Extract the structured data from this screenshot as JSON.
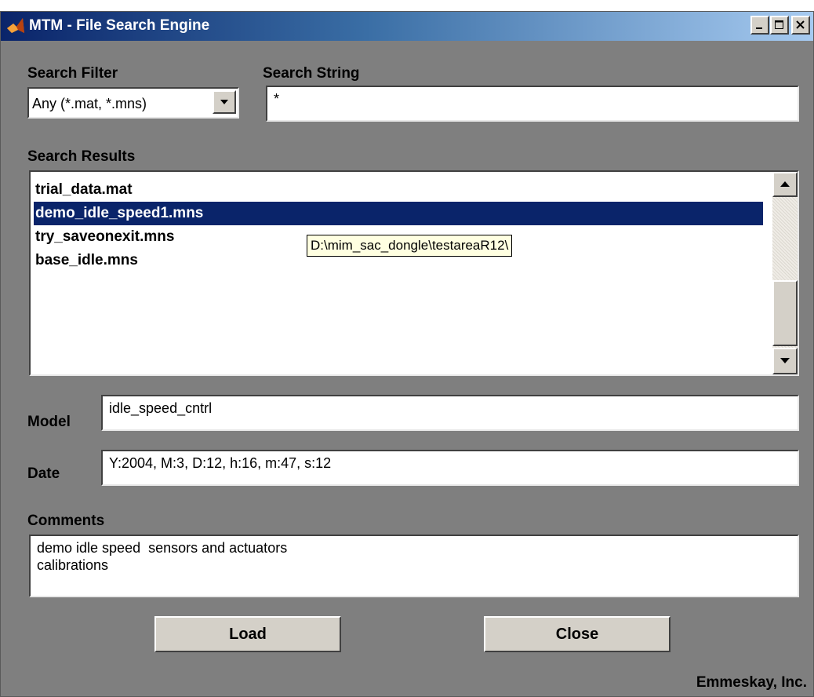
{
  "window": {
    "title": "MTM - File Search Engine",
    "icon": "matlab-icon",
    "controls": [
      "minimize-icon",
      "maximize-icon",
      "close-icon"
    ]
  },
  "search_filter": {
    "label": "Search Filter",
    "value": "Any (*.mat, *.mns)"
  },
  "search_string": {
    "label": "Search String",
    "value": "*"
  },
  "results": {
    "label": "Search Results",
    "items": [
      "trial_data.mat",
      "demo_idle_speed1.mns",
      "try_saveonexit.mns",
      "base_idle.mns"
    ],
    "selected_index": 1,
    "tooltip": "D:\\mim_sac_dongle\\testareaR12\\"
  },
  "model": {
    "label": "Model",
    "value": "idle_speed_cntrl"
  },
  "date": {
    "label": "Date",
    "value": "Y:2004, M:3, D:12, h:16, m:47, s:12"
  },
  "comments": {
    "label": "Comments",
    "value": "demo idle speed  sensors and actuators\ncalibrations"
  },
  "buttons": {
    "load": "Load",
    "close": "Close"
  },
  "footer": "Emmeskay, Inc.",
  "colors": {
    "background": "#7f7f7f",
    "selection": "#0a246a",
    "titlebar_start": "#0a246a",
    "titlebar_end": "#a6caf0"
  }
}
